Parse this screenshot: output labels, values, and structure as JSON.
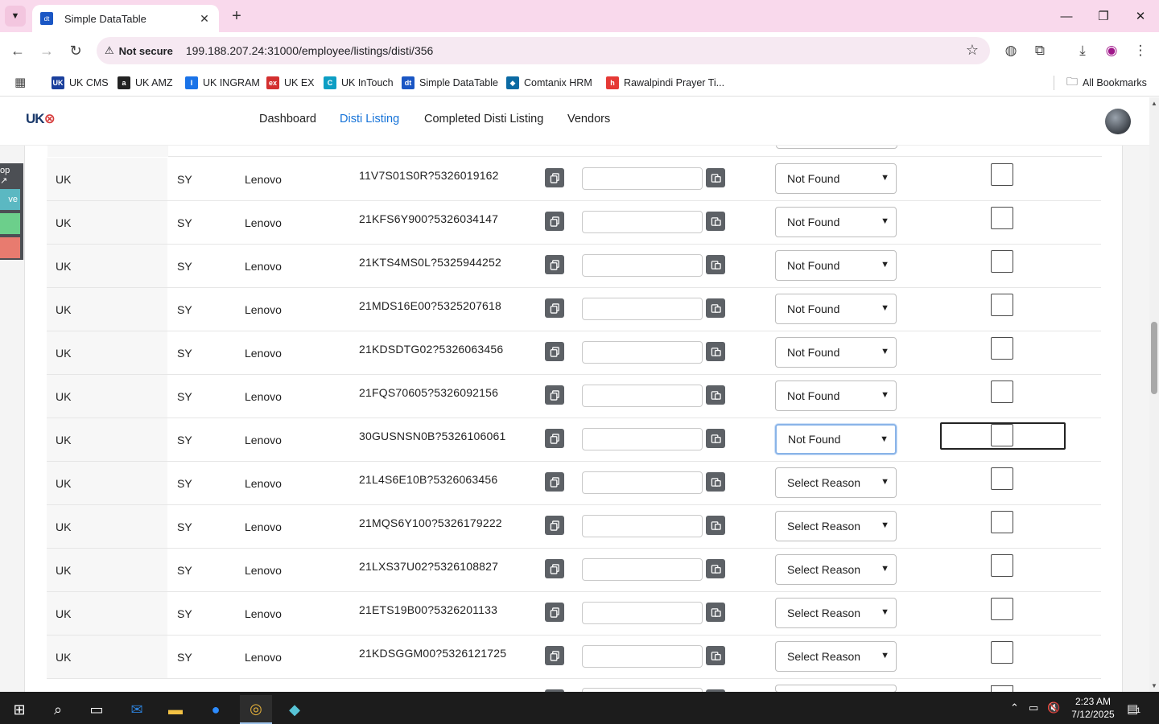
{
  "browser": {
    "tab_title": "Simple DataTable",
    "tab_favicon": "dt",
    "security_label": "Not secure",
    "url": "199.188.207.24:31000/employee/listings/disti/356",
    "bookmarks": [
      {
        "label": "UK CMS",
        "icon": "uk-cms-icon",
        "color": "#1a3f9c",
        "glyph": "UK"
      },
      {
        "label": "UK AMZ",
        "icon": "amazon-icon",
        "color": "#222222",
        "glyph": "a"
      },
      {
        "label": "UK INGRAM",
        "icon": "ingram-icon",
        "color": "#1a73e8",
        "glyph": "I"
      },
      {
        "label": "UK EX",
        "icon": "ex-icon",
        "color": "#d32f2f",
        "glyph": "ex"
      },
      {
        "label": "UK InTouch",
        "icon": "intouch-icon",
        "color": "#0d9ec4",
        "glyph": "C"
      },
      {
        "label": "Simple DataTable",
        "icon": "datatable-icon",
        "color": "#1a56c4",
        "glyph": "dt"
      },
      {
        "label": "Comtanix HRM",
        "icon": "comtanix-icon",
        "color": "#0b6aa3",
        "glyph": "◆"
      },
      {
        "label": "Rawalpindi Prayer Ti...",
        "icon": "prayer-icon",
        "color": "#e53935",
        "glyph": "h"
      }
    ],
    "all_bookmarks_label": "All Bookmarks"
  },
  "app": {
    "logo": "UK",
    "nav": [
      {
        "label": "Dashboard",
        "active": false
      },
      {
        "label": "Disti Listing",
        "active": true
      },
      {
        "label": "Completed Disti Listing",
        "active": false
      },
      {
        "label": "Vendors",
        "active": false
      }
    ],
    "side_buttons": [
      {
        "label": "op ↗",
        "color": "#4c4f54"
      },
      {
        "label": "ve",
        "color": "#5bb8c2"
      },
      {
        "label": "",
        "color": "#6ccf8b"
      },
      {
        "label": "",
        "color": "#e87b6f"
      }
    ]
  },
  "table": {
    "rows": [
      {
        "country": "UK",
        "code": "SY",
        "brand": "Lenovo",
        "sku": "11V7S01S0R?5326019162",
        "reason": "Not Found",
        "focused": false
      },
      {
        "country": "UK",
        "code": "SY",
        "brand": "Lenovo",
        "sku": "21KFS6Y900?5326034147",
        "reason": "Not Found",
        "focused": false
      },
      {
        "country": "UK",
        "code": "SY",
        "brand": "Lenovo",
        "sku": "21KTS4MS0L?5325944252",
        "reason": "Not Found",
        "focused": false
      },
      {
        "country": "UK",
        "code": "SY",
        "brand": "Lenovo",
        "sku": "21MDS16E00?5325207618",
        "reason": "Not Found",
        "focused": false
      },
      {
        "country": "UK",
        "code": "SY",
        "brand": "Lenovo",
        "sku": "21KDSDTG02?5326063456",
        "reason": "Not Found",
        "focused": false
      },
      {
        "country": "UK",
        "code": "SY",
        "brand": "Lenovo",
        "sku": "21FQS70605?5326092156",
        "reason": "Not Found",
        "focused": false
      },
      {
        "country": "UK",
        "code": "SY",
        "brand": "Lenovo",
        "sku": "30GUSNSN0B?5326106061",
        "reason": "Not Found",
        "focused": true
      },
      {
        "country": "UK",
        "code": "SY",
        "brand": "Lenovo",
        "sku": "21L4S6E10B?5326063456",
        "reason": "Select Reason",
        "focused": false
      },
      {
        "country": "UK",
        "code": "SY",
        "brand": "Lenovo",
        "sku": "21MQS6Y100?5326179222",
        "reason": "Select Reason",
        "focused": false
      },
      {
        "country": "UK",
        "code": "SY",
        "brand": "Lenovo",
        "sku": "21LXS37U02?5326108827",
        "reason": "Select Reason",
        "focused": false
      },
      {
        "country": "UK",
        "code": "SY",
        "brand": "Lenovo",
        "sku": "21ETS19B00?5326201133",
        "reason": "Select Reason",
        "focused": false
      },
      {
        "country": "UK",
        "code": "SY",
        "brand": "Lenovo",
        "sku": "21KDSGGM00?5326121725",
        "reason": "Select Reason",
        "focused": false
      }
    ]
  },
  "taskbar": {
    "time": "2:23 AM",
    "date": "7/12/2025",
    "notification_count": "1"
  }
}
